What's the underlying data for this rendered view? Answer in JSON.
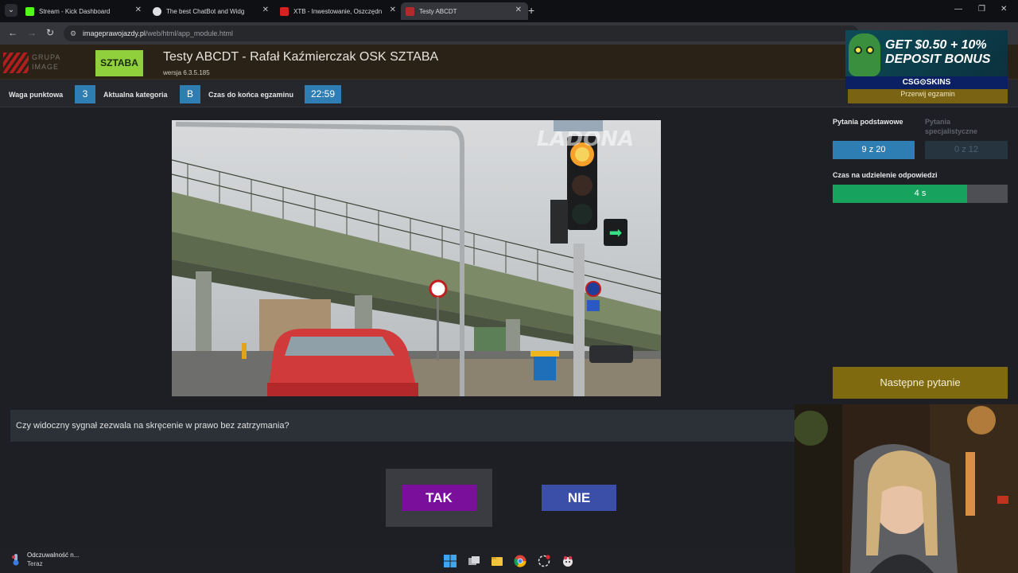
{
  "browser": {
    "tabs": [
      {
        "title": "Stream - Kick Dashboard",
        "favicon_color": "#53fc18"
      },
      {
        "title": "The best ChatBot and Widg",
        "favicon_color": "#dfe0e3"
      },
      {
        "title": "XTB - Inwestowanie, Oszczędn",
        "favicon_color": "#d82222"
      },
      {
        "title": "Testy ABCDT",
        "favicon_color": "#b12b2b"
      }
    ],
    "address": {
      "domain": "imageprawojazdy.pl",
      "path": "/web/html/app_module.html"
    }
  },
  "header": {
    "logo_left_text": "GRUPA IMAGE",
    "logo_right_text": "SZTABA",
    "title": "Testy ABCDT - Rafał Kaźmierczak OSK SZTABA",
    "version": "wersja 6.3.5.185"
  },
  "infobar": {
    "weight_label": "Waga punktowa",
    "weight_value": "3",
    "category_label": "Aktualna kategoria",
    "category_value": "B",
    "time_label": "Czas do końca egzaminu",
    "time_value": "22:59",
    "abort_label": "Przerwij egzamin"
  },
  "scene": {
    "watermark": "LADONA"
  },
  "right_panel": {
    "basic_label": "Pytania podstawowe",
    "basic_value": "9 z 20",
    "specialist_label": "Pytania specjalistyczne",
    "specialist_value": "0 z 12",
    "answer_time_label": "Czas na udzielenie odpowiedzi",
    "answer_time_value": "4 s",
    "answer_time_fraction": 0.77,
    "next_label": "Następne pytanie"
  },
  "question": {
    "text": "Czy widoczny sygnał zezwala na skręcenie w prawo bez zatrzymania?",
    "yes_label": "TAK",
    "no_label": "NIE"
  },
  "ad": {
    "line1": "GET $0.50 + 10%",
    "line2": "DEPOSIT BONUS",
    "brand": "CSG⊙SKINS"
  },
  "taskbar": {
    "notification_title": "Odczuwalność n...",
    "notification_time": "Teraz"
  },
  "colors": {
    "accent_blue": "#2f7eb3",
    "timer_green": "#17a35d",
    "gold": "#7f6a10",
    "yes_purple": "#7a0f9c",
    "no_blue": "#3b4fa8"
  }
}
